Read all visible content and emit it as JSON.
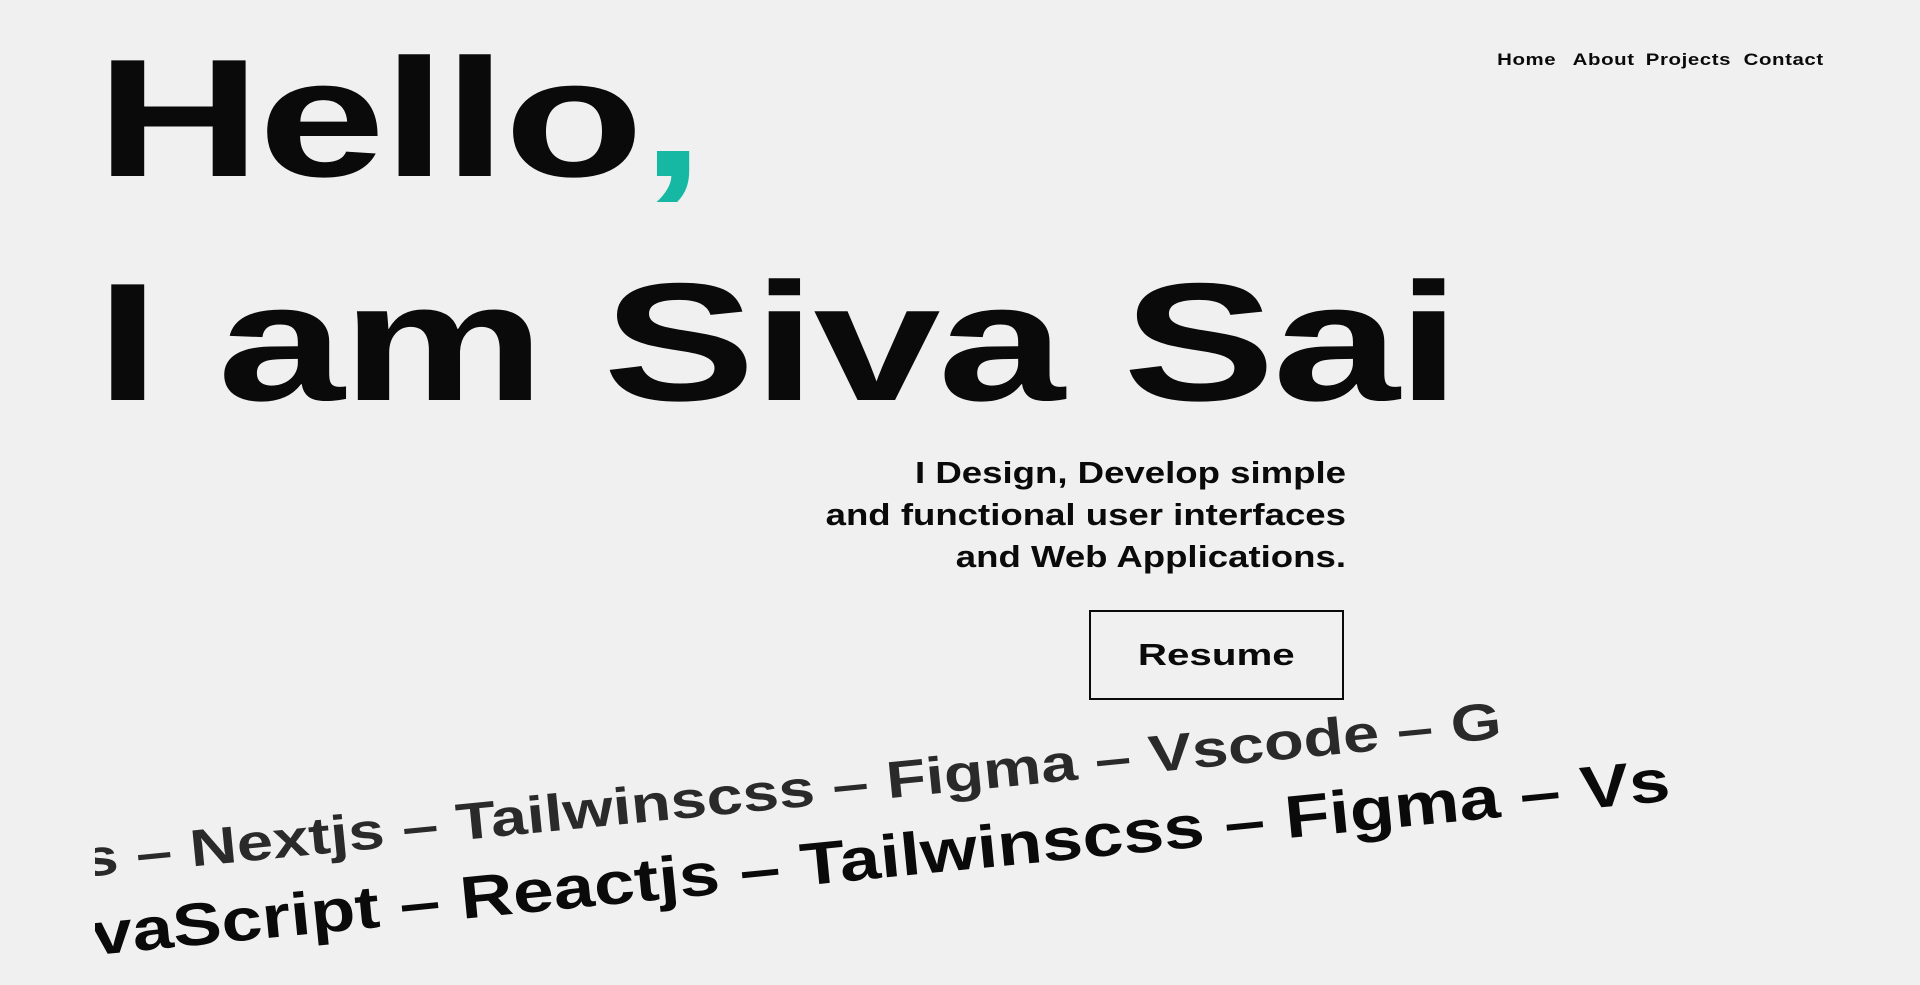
{
  "nav": {
    "items": [
      "Home",
      "About",
      "Projects",
      "Contact"
    ]
  },
  "hero": {
    "greeting": "Hello",
    "comma": ",",
    "name": "I am Siva Sai"
  },
  "tagline": [
    "I Design, Develop simple",
    "and functional user interfaces",
    "and Web Applications."
  ],
  "resume_label": "Resume",
  "marquee": {
    "row1": "s – Nextjs – Tailwinscss – Figma – Vscode – G",
    "row2": "vaScript – Reactjs – Tailwinscss – Figma – Vs"
  },
  "colors": {
    "accent": "#16b8a3",
    "text": "#0a0a0a",
    "background": "#f0f0f0"
  }
}
